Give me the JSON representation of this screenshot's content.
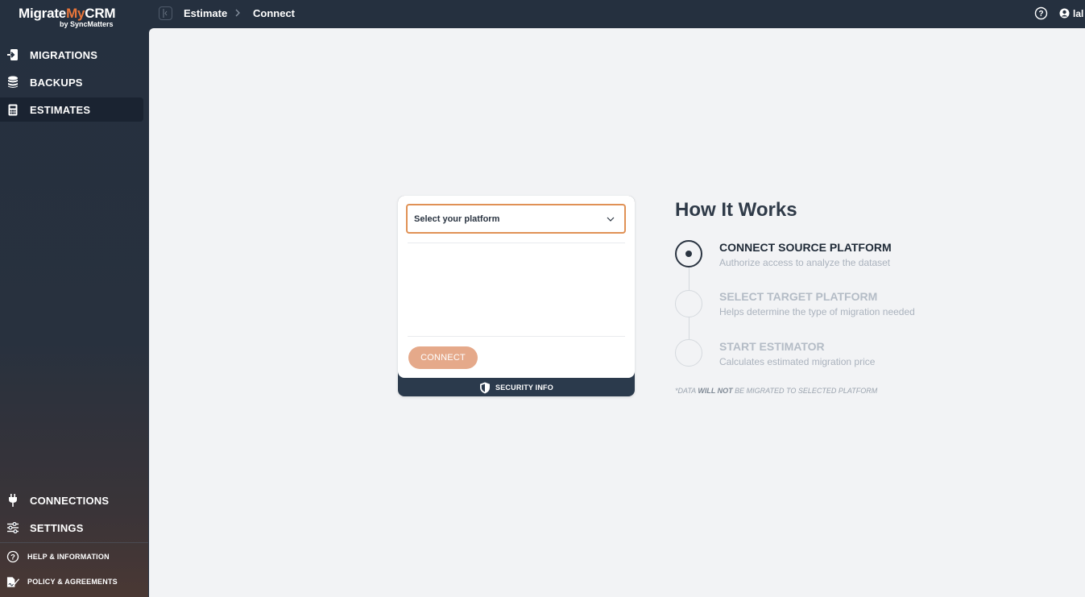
{
  "app": {
    "logo_text_1": "Migrate",
    "logo_text_2": "My",
    "logo_text_3": "CRM",
    "logo_sub": "by SyncMatters",
    "brand_accent": "#e8753a"
  },
  "breadcrumb": [
    "Estimate",
    "Connect"
  ],
  "topbar": {
    "user_name": "lal"
  },
  "sidebar": {
    "items": [
      {
        "label": "MIGRATIONS",
        "icon": "migrations-icon"
      },
      {
        "label": "BACKUPS",
        "icon": "database-icon"
      },
      {
        "label": "ESTIMATES",
        "icon": "calculator-icon",
        "active": true
      }
    ],
    "bottom_items": [
      {
        "label": "CONNECTIONS",
        "icon": "plug-icon"
      },
      {
        "label": "SETTINGS",
        "icon": "sliders-icon"
      },
      {
        "label": "HELP & INFORMATION",
        "icon": "help-circle-icon"
      },
      {
        "label": "POLICY & AGREEMENTS",
        "icon": "document-sign-icon"
      }
    ]
  },
  "connect_card": {
    "select_placeholder": "Select your platform",
    "connect_label": "CONNECT",
    "security_label": "SECURITY INFO"
  },
  "how_it_works": {
    "title": "How It Works",
    "steps": [
      {
        "title": "CONNECT SOURCE PLATFORM",
        "desc": "Authorize access to analyze the dataset",
        "active": true
      },
      {
        "title": "SELECT TARGET PLATFORM",
        "desc": "Helps determine the type of migration needed",
        "active": false
      },
      {
        "title": "START ESTIMATOR",
        "desc": "Calculates estimated migration price",
        "active": false
      }
    ],
    "footnote_pre": "*DATA ",
    "footnote_bold": "WILL NOT",
    "footnote_post": " BE MIGRATED TO SELECTED PLATFORM"
  },
  "colors": {
    "sidebar_bg": "#25303f",
    "active_nav": "#1a2331",
    "select_border": "#e09155",
    "connect_button": "#e5a98a"
  }
}
